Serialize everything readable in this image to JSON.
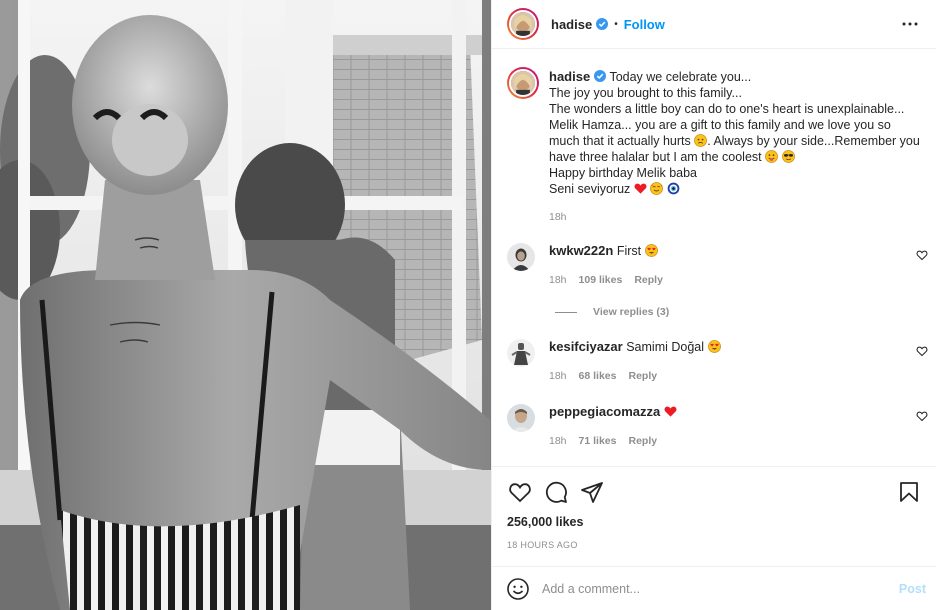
{
  "header": {
    "username": "hadise",
    "separator": "•",
    "follow_label": "Follow"
  },
  "caption": {
    "username": "hadise",
    "lines": [
      "Today we celebrate you...",
      "The joy you brought to this family...",
      "The wonders a little boy can do to one's heart is unexplainable...",
      "Melik Hamza... you are a gift to this family and we love you so",
      "much that it actually hurts",
      ". Always by your side...Remember you",
      "have three halalar but I am the coolest",
      "Happy birthday Melik baba",
      "Seni seviyoruz"
    ],
    "time": "18h"
  },
  "comments": [
    {
      "username": "kwkw222n",
      "text": "First",
      "time": "18h",
      "likes": "109 likes",
      "reply_label": "Reply",
      "view_replies": "View replies (3)"
    },
    {
      "username": "kesifciyazar",
      "text": "Samimi Doğal",
      "time": "18h",
      "likes": "68 likes",
      "reply_label": "Reply"
    },
    {
      "username": "peppegiacomazza",
      "text": "",
      "time": "18h",
      "likes": "71 likes",
      "reply_label": "Reply"
    }
  ],
  "icons": {
    "like": "heart-icon",
    "comment": "comment-icon",
    "share": "share-icon",
    "save": "bookmark-icon",
    "more": "more-options-icon",
    "emoji": "emoji-icon"
  },
  "stats": {
    "likes": "256,000 likes",
    "posted": "18 HOURS AGO"
  },
  "add_comment": {
    "placeholder": "Add a comment...",
    "post_label": "Post"
  },
  "colors": {
    "link_blue": "#0095f6",
    "post_disabled": "#b2dffc",
    "muted": "#8e8e8e",
    "text": "#262626",
    "emoji_heart": "#ed1c24"
  }
}
